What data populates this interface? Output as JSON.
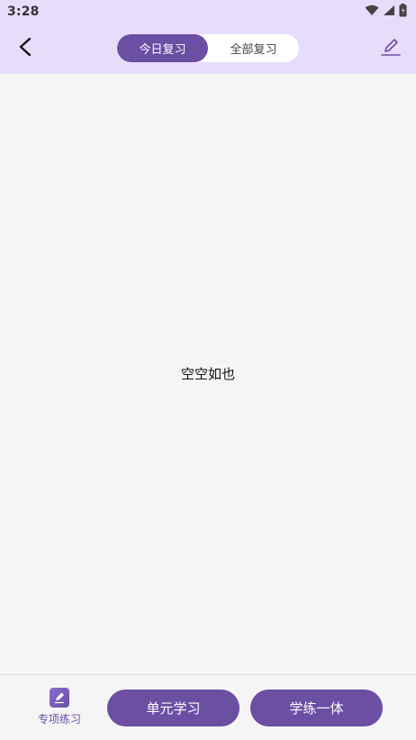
{
  "status_bar": {
    "time": "3:28",
    "icons": [
      "wifi-icon",
      "signal-icon",
      "battery-icon"
    ]
  },
  "header": {
    "back_icon": "back-arrow-icon",
    "tabs": [
      {
        "label": "今日复习",
        "active": true
      },
      {
        "label": "全部复习",
        "active": false
      }
    ],
    "edit_icon": "edit-pencil-icon"
  },
  "content": {
    "empty_text": "空空如也"
  },
  "bottom_bar": {
    "special_practice": {
      "label": "专项练习",
      "icon": "pencil-note-icon"
    },
    "unit_study_label": "单元学习",
    "integrated_label": "学练一体"
  },
  "colors": {
    "accent": "#6a4fa3",
    "header_bg": "#e8dcfb",
    "page_bg": "#f5f5f5"
  }
}
